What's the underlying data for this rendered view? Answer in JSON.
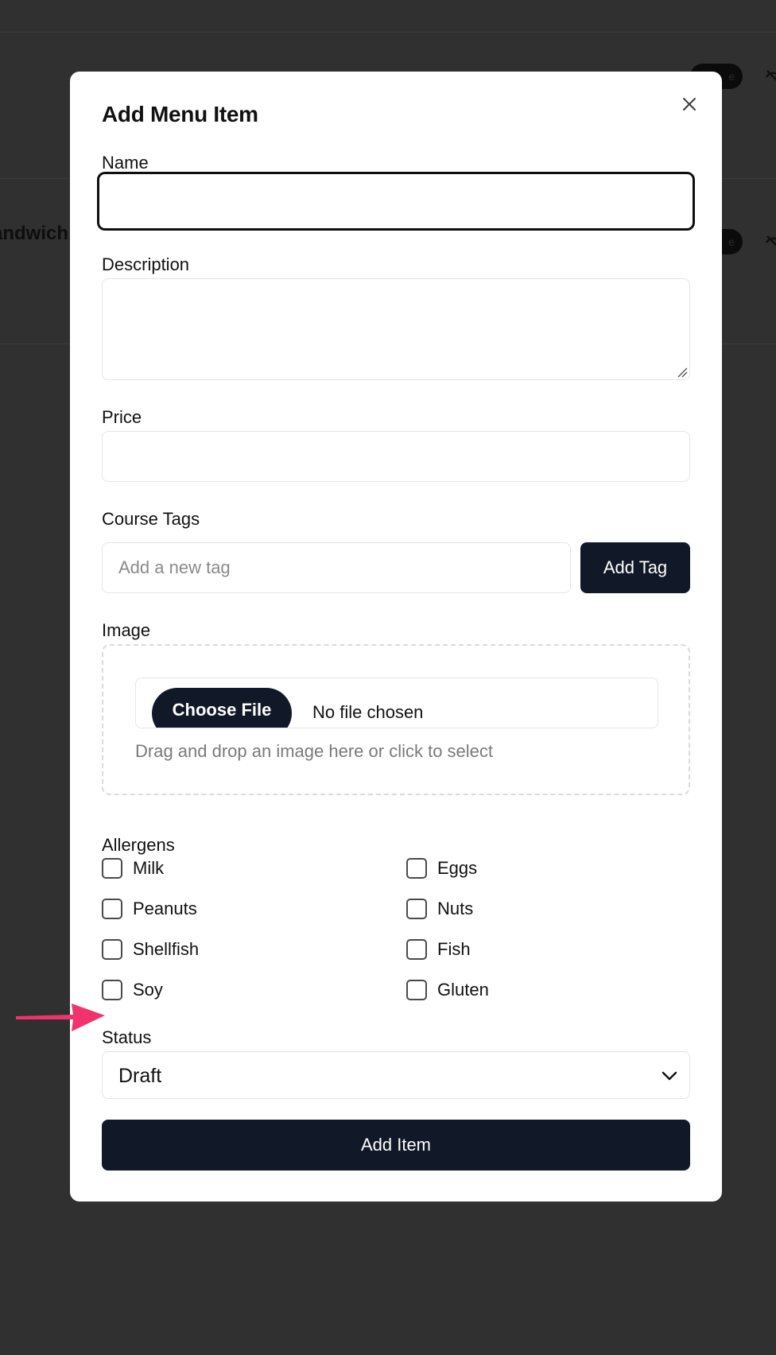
{
  "background": {
    "row_title": "andwich",
    "pill_label": "e"
  },
  "modal": {
    "title": "Add Menu Item",
    "close_icon": "close-icon",
    "fields": {
      "name_label": "Name",
      "name_value": "",
      "description_label": "Description",
      "description_value": "",
      "price_label": "Price",
      "price_value": ""
    },
    "tags": {
      "label": "Course Tags",
      "placeholder": "Add a new tag",
      "add_button": "Add Tag"
    },
    "image": {
      "label": "Image",
      "choose_button": "Choose File",
      "file_status": "No file chosen",
      "hint": "Drag and drop an image here or click to select"
    },
    "allergens": {
      "label": "Allergens",
      "items": [
        {
          "label": "Milk",
          "checked": false
        },
        {
          "label": "Eggs",
          "checked": false
        },
        {
          "label": "Peanuts",
          "checked": false
        },
        {
          "label": "Nuts",
          "checked": false
        },
        {
          "label": "Shellfish",
          "checked": false
        },
        {
          "label": "Fish",
          "checked": false
        },
        {
          "label": "Soy",
          "checked": false
        },
        {
          "label": "Gluten",
          "checked": false
        }
      ]
    },
    "status": {
      "label": "Status",
      "value": "Draft"
    },
    "submit_label": "Add Item"
  },
  "colors": {
    "primary": "#111827",
    "overlay": "#303030",
    "annotation": "#f0336e"
  }
}
